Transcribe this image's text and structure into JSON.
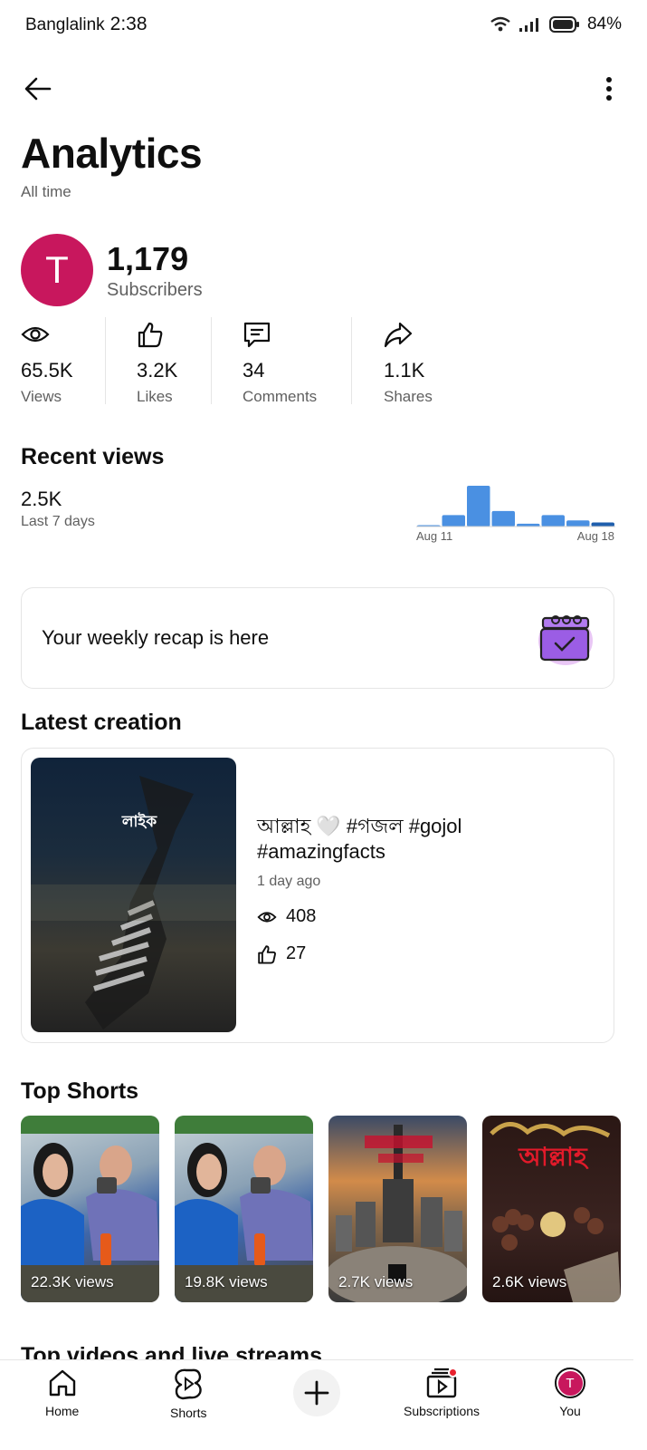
{
  "status": {
    "carrier": "Banglalink",
    "time": "2:38",
    "battery": "84%"
  },
  "page": {
    "title": "Analytics",
    "subtitle": "All time"
  },
  "channel": {
    "avatar_letter": "T",
    "subscribers": "1,179",
    "subscribers_label": "Subscribers"
  },
  "stats": [
    {
      "icon": "eye-icon",
      "value": "65.5K",
      "label": "Views"
    },
    {
      "icon": "thumbs-up-icon",
      "value": "3.2K",
      "label": "Likes"
    },
    {
      "icon": "comment-icon",
      "value": "34",
      "label": "Comments"
    },
    {
      "icon": "share-icon",
      "value": "1.1K",
      "label": "Shares"
    }
  ],
  "recent_views": {
    "title": "Recent views",
    "value": "2.5K",
    "period": "Last 7 days",
    "start_label": "Aug 11",
    "end_label": "Aug 18"
  },
  "chart_data": {
    "type": "bar",
    "categories": [
      "Aug 11",
      "",
      "",
      "",
      "",
      "",
      "",
      "Aug 18"
    ],
    "values": [
      0.02,
      0.28,
      1.0,
      0.38,
      0.07,
      0.28,
      0.15,
      0.1
    ],
    "title": "",
    "xlabel": "",
    "ylabel": "",
    "colors": [
      "#4a90e2",
      "#4a90e2",
      "#4a90e2",
      "#4a90e2",
      "#4a90e2",
      "#4a90e2",
      "#4a90e2",
      "#1f5fad"
    ]
  },
  "recap": {
    "text": "Your weekly recap is here",
    "icon": "clapperboard-icon"
  },
  "latest": {
    "section_title": "Latest creation",
    "thumb_text": "লাইক",
    "title": "আল্লাহ 🤍  #গজল #gojol #amazingfacts",
    "time": "1 day ago",
    "views": "408",
    "likes": "27"
  },
  "top_shorts": {
    "section_title": "Top Shorts",
    "items": [
      {
        "views": "22.3K views"
      },
      {
        "views": "19.8K views"
      },
      {
        "views": "2.7K views"
      },
      {
        "views": "2.6K views",
        "overlay_text": "আল্লাহ"
      }
    ]
  },
  "top_videos": {
    "section_title": "Top videos and live streams"
  },
  "nav": {
    "items": [
      {
        "label": "Home",
        "icon": "home-icon"
      },
      {
        "label": "Shorts",
        "icon": "shorts-icon"
      },
      {
        "label": "",
        "icon": "create-icon"
      },
      {
        "label": "Subscriptions",
        "icon": "subscriptions-icon"
      },
      {
        "label": "You",
        "icon": "avatar"
      }
    ],
    "avatar_letter": "T"
  },
  "colors": {
    "accent": "#c8175d",
    "bar": "#4a90e2",
    "badge": "#e8212e"
  }
}
